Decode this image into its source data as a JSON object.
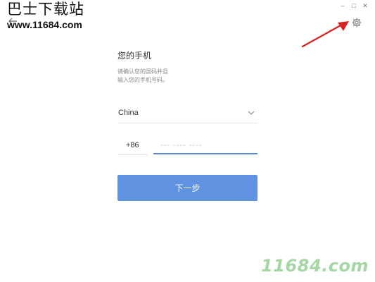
{
  "window": {
    "controls": {
      "minimize": "–",
      "maximize": "□",
      "close": "✕"
    }
  },
  "watermark_top": {
    "line1": "巴士下载站",
    "line2": "www.11684.com"
  },
  "watermark_bottom": "11684.com",
  "icons": {
    "back": "back-arrow-icon",
    "settings": "gear-icon",
    "dropdown": "chevron-down-icon"
  },
  "form": {
    "title": "您的手机",
    "description_line1": "请确认您的国码并且",
    "description_line2": "输入您的手机号码。",
    "country": "China",
    "country_code": "+86",
    "phone_placeholder": "--- ---- ----",
    "next_button": "下一步"
  },
  "colors": {
    "accent": "#5f92e0",
    "input_underline": "#5a8bd6",
    "annotation_arrow": "#d62424",
    "watermark_green": "#5cb85c"
  }
}
